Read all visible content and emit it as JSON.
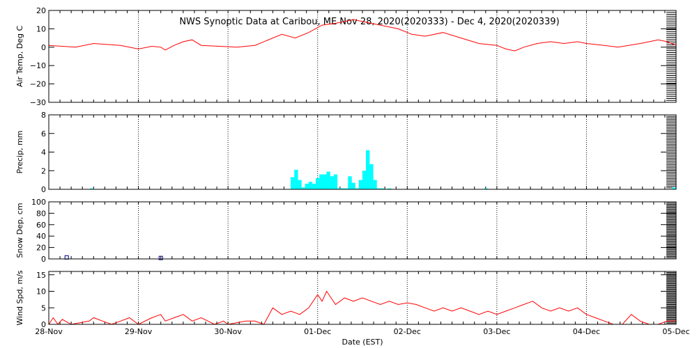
{
  "chart_data": {
    "title": "NWS Synoptic Data at Caribou, ME   Nov 28, 2020(2020333) - Dec  4, 2020(2020339)",
    "xlabel": "Date (EST)",
    "x_tick_labels": [
      "28-Nov",
      "29-Nov",
      "30-Nov",
      "01-Dec",
      "02-Dec",
      "03-Dec",
      "04-Dec",
      "05-Dec"
    ],
    "x_range_days": [
      0,
      7
    ],
    "vertical_grid": true,
    "colors": {
      "line": "#ff0000",
      "bar": "#00ffff",
      "snow": "#000080",
      "axis": "#000000"
    },
    "panels": [
      {
        "type": "line",
        "ylabel": "Air Temp, Deg C",
        "ylim": [
          -30,
          20
        ],
        "yticks": [
          -30,
          -20,
          -10,
          0,
          10,
          20
        ],
        "ytick_labels": [
          "−30",
          "−20",
          "−10",
          "0",
          "10",
          "20"
        ],
        "series": [
          {
            "x": [
              0,
              0.3,
              0.5,
              0.8,
              1.0,
              1.15,
              1.25,
              1.3,
              1.4,
              1.5,
              1.6,
              1.7,
              1.9,
              2.1,
              2.3,
              2.6,
              2.75,
              2.9,
              3.05,
              3.2,
              3.4,
              3.6,
              3.8,
              3.9,
              4.05,
              4.2,
              4.4,
              4.6,
              4.8,
              5.0,
              5.1,
              5.2,
              5.3,
              5.45,
              5.6,
              5.75,
              5.9,
              6.0,
              6.2,
              6.35,
              6.6,
              6.8,
              6.9,
              7.0
            ],
            "y": [
              1,
              0,
              2,
              1,
              -1,
              0.5,
              0,
              -1.5,
              1,
              3,
              4,
              1,
              0.5,
              0,
              1,
              7,
              5,
              8,
              12,
              13,
              15,
              13,
              11,
              10,
              7,
              6,
              8,
              5,
              2,
              1,
              -1,
              -2,
              0,
              2,
              3,
              2,
              3,
              2,
              1,
              0,
              2,
              4,
              3,
              1
            ]
          }
        ]
      },
      {
        "type": "bar",
        "ylabel": "Precip, mm",
        "ylim": [
          0,
          8
        ],
        "yticks": [
          0,
          2,
          4,
          6,
          8
        ],
        "ytick_labels": [
          "0",
          "2",
          "4",
          "6",
          "8"
        ],
        "bar_width_days": 0.04166,
        "series": [
          {
            "x": [
              0.48,
              2.72,
              2.76,
              2.8,
              2.84,
              2.88,
              2.92,
              2.96,
              3.0,
              3.04,
              3.08,
              3.12,
              3.16,
              3.2,
              3.24,
              3.28,
              3.32,
              3.36,
              3.4,
              3.44,
              3.48,
              3.52,
              3.56,
              3.6,
              3.64,
              3.68,
              3.72,
              3.8,
              4.88,
              6.98
            ],
            "y": [
              0.1,
              1.3,
              2.1,
              1.0,
              0.2,
              0.6,
              0.8,
              0.6,
              1.2,
              1.6,
              1.6,
              1.9,
              1.4,
              1.6,
              0.1,
              0.1,
              0.1,
              1.4,
              0.7,
              0.1,
              1.0,
              2.0,
              4.2,
              2.7,
              1.0,
              0.1,
              0.1,
              0.1,
              0.1,
              0.2
            ]
          }
        ]
      },
      {
        "type": "scatter",
        "ylabel": "Snow Dep, cm",
        "ylim": [
          0,
          100
        ],
        "yticks": [
          0,
          20,
          40,
          60,
          80,
          100
        ],
        "ytick_labels": [
          "0",
          "20",
          "40",
          "60",
          "80",
          "100"
        ],
        "series": [
          {
            "x": [
              0.2,
              1.25
            ],
            "y": [
              2,
              1
            ]
          }
        ]
      },
      {
        "type": "line",
        "ylabel": "Wind Spd, m/s",
        "ylim": [
          0,
          16
        ],
        "yticks": [
          0,
          5,
          10,
          15
        ],
        "ytick_labels": [
          "0",
          "5",
          "10",
          "15"
        ],
        "series": [
          {
            "x": [
              0,
              0.05,
              0.1,
              0.15,
              0.25,
              0.35,
              0.45,
              0.5,
              0.6,
              0.7,
              0.8,
              0.9,
              1.0,
              1.15,
              1.25,
              1.3,
              1.4,
              1.5,
              1.6,
              1.7,
              1.85,
              1.95,
              2.0,
              2.1,
              2.2,
              2.3,
              2.4,
              2.5,
              2.6,
              2.7,
              2.8,
              2.9,
              3.0,
              3.05,
              3.1,
              3.15,
              3.2,
              3.3,
              3.4,
              3.5,
              3.6,
              3.7,
              3.8,
              3.9,
              4.0,
              4.1,
              4.2,
              4.3,
              4.4,
              4.5,
              4.6,
              4.7,
              4.8,
              4.9,
              5.0,
              5.1,
              5.2,
              5.3,
              5.4,
              5.5,
              5.6,
              5.7,
              5.8,
              5.9,
              6.0,
              6.1,
              6.2,
              6.3,
              6.4,
              6.5,
              6.6,
              6.7,
              6.8,
              6.9,
              7.0
            ],
            "y": [
              0,
              2,
              0,
              1.5,
              0,
              0.5,
              1,
              2,
              1,
              0,
              1,
              2,
              0,
              2,
              3,
              1,
              2,
              3,
              1,
              2,
              0,
              1,
              0,
              0.5,
              1,
              1,
              0,
              5,
              3,
              4,
              3,
              5,
              9,
              7,
              10,
              8,
              6,
              8,
              7,
              8,
              7,
              6,
              7,
              6,
              6.5,
              6,
              5,
              4,
              5,
              4,
              5,
              4,
              3,
              4,
              3,
              4,
              5,
              6,
              7,
              5,
              4,
              5,
              4,
              5,
              3,
              2,
              1,
              0,
              0,
              3,
              1,
              0,
              0,
              1,
              1
            ]
          }
        ]
      }
    ]
  }
}
